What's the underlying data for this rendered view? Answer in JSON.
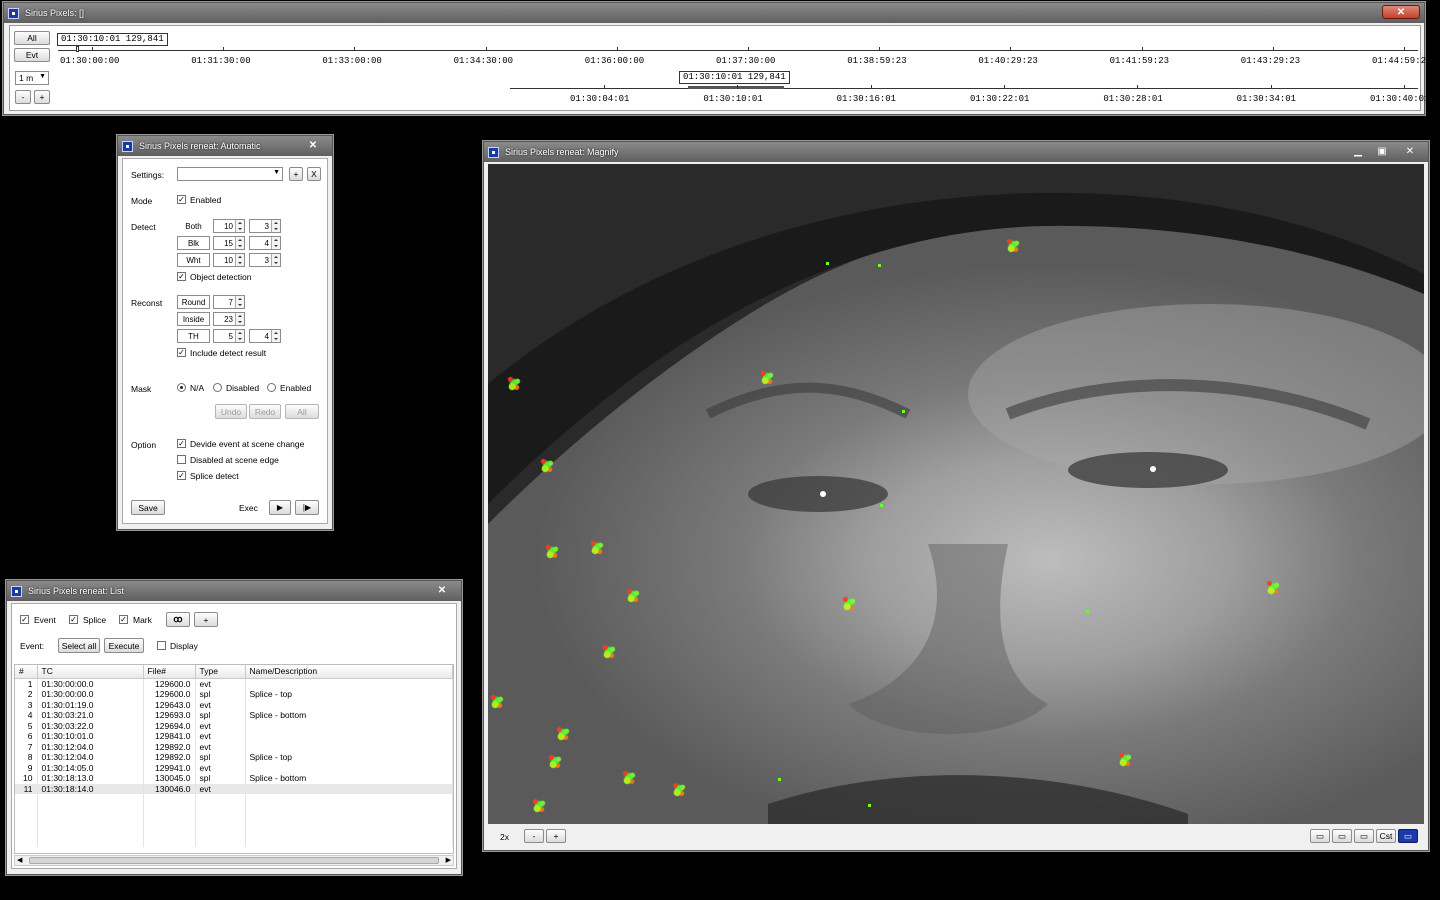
{
  "timeline_window": {
    "title": "Sirius Pixels: []",
    "btn_all": "All",
    "btn_evt": "Evt",
    "scale_value": "1 m",
    "btn_minus": "-",
    "btn_plus": "+",
    "cursor_top": "01:30:10:01 129,841",
    "cursor_bottom": "01:30:10:01 129,841",
    "ticks_top": [
      "01:30:00:00",
      "01:31:30:00",
      "01:33:00:00",
      "01:34:30:00",
      "01:36:00:00",
      "01:37:30:00",
      "01:38:59:23",
      "01:40:29:23",
      "01:41:59:23",
      "01:43:29:23",
      "01:44:59:23"
    ],
    "ticks_bottom": [
      "01:30:04:01",
      "01:30:10:01",
      "01:30:16:01",
      "01:30:22:01",
      "01:30:28:01",
      "01:30:34:01",
      "01:30:40:01"
    ]
  },
  "automatic_window": {
    "title": "Sirius Pixels reneat: Automatic",
    "settings_label": "Settings:",
    "settings_value": "",
    "add_btn": "+",
    "remove_btn": "X",
    "mode_label": "Mode",
    "mode_enabled": "Enabled",
    "detect_label": "Detect",
    "detect_rows": [
      {
        "name": "Both",
        "v1": "10",
        "v2": "3"
      },
      {
        "name": "Blk",
        "v1": "15",
        "v2": "4"
      },
      {
        "name": "Wht",
        "v1": "10",
        "v2": "3"
      }
    ],
    "object_detection": "Object detection",
    "reconst_label": "Reconst",
    "reconst_rows": [
      {
        "name": "Round",
        "v1": "7"
      },
      {
        "name": "Inside",
        "v1": "23"
      },
      {
        "name": "TH",
        "v1": "5",
        "v2": "4"
      }
    ],
    "include_detect": "Include detect result",
    "mask_label": "Mask",
    "mask_options": [
      "N/A",
      "Disabled",
      "Enabled"
    ],
    "undo": "Undo",
    "redo": "Redo",
    "all": "All",
    "option_label": "Option",
    "options": [
      "Devide event at scene change",
      "Disabled at scene edge",
      "Splice detect"
    ],
    "save": "Save",
    "exec": "Exec"
  },
  "list_window": {
    "title": "Sirius Pixels reneat: List",
    "filters": [
      "Event",
      "Splice",
      "Mark"
    ],
    "plus": "+",
    "event_label": "Event:",
    "select_all": "Select all",
    "execute": "Execute",
    "display": "Display",
    "columns": [
      "#",
      "TC",
      "File#",
      "Type",
      "Name/Description"
    ],
    "rows": [
      [
        "1",
        "01:30:00:00.0",
        "129600.0",
        "evt",
        ""
      ],
      [
        "2",
        "01:30:00:00.0",
        "129600.0",
        "spl",
        "Splice - top"
      ],
      [
        "3",
        "01:30:01:19.0",
        "129643.0",
        "evt",
        ""
      ],
      [
        "4",
        "01:30:03:21.0",
        "129693.0",
        "spl",
        "Splice - bottom"
      ],
      [
        "5",
        "01:30:03:22.0",
        "129694.0",
        "evt",
        ""
      ],
      [
        "6",
        "01:30:10:01.0",
        "129841.0",
        "evt",
        ""
      ],
      [
        "7",
        "01:30:12:04.0",
        "129892.0",
        "evt",
        ""
      ],
      [
        "8",
        "01:30:12:04.0",
        "129892.0",
        "spl",
        "Splice - top"
      ],
      [
        "9",
        "01:30:14:05.0",
        "129941.0",
        "evt",
        ""
      ],
      [
        "10",
        "01:30:18:13.0",
        "130045.0",
        "spl",
        "Splice - bottom"
      ],
      [
        "11",
        "01:30:18:14.0",
        "130046.0",
        "evt",
        ""
      ]
    ]
  },
  "magnify_window": {
    "title": "Sirius Pixels reneat: Magnify",
    "zoom": "2x",
    "minus": "-",
    "plus": "+",
    "cst": "Cst"
  }
}
